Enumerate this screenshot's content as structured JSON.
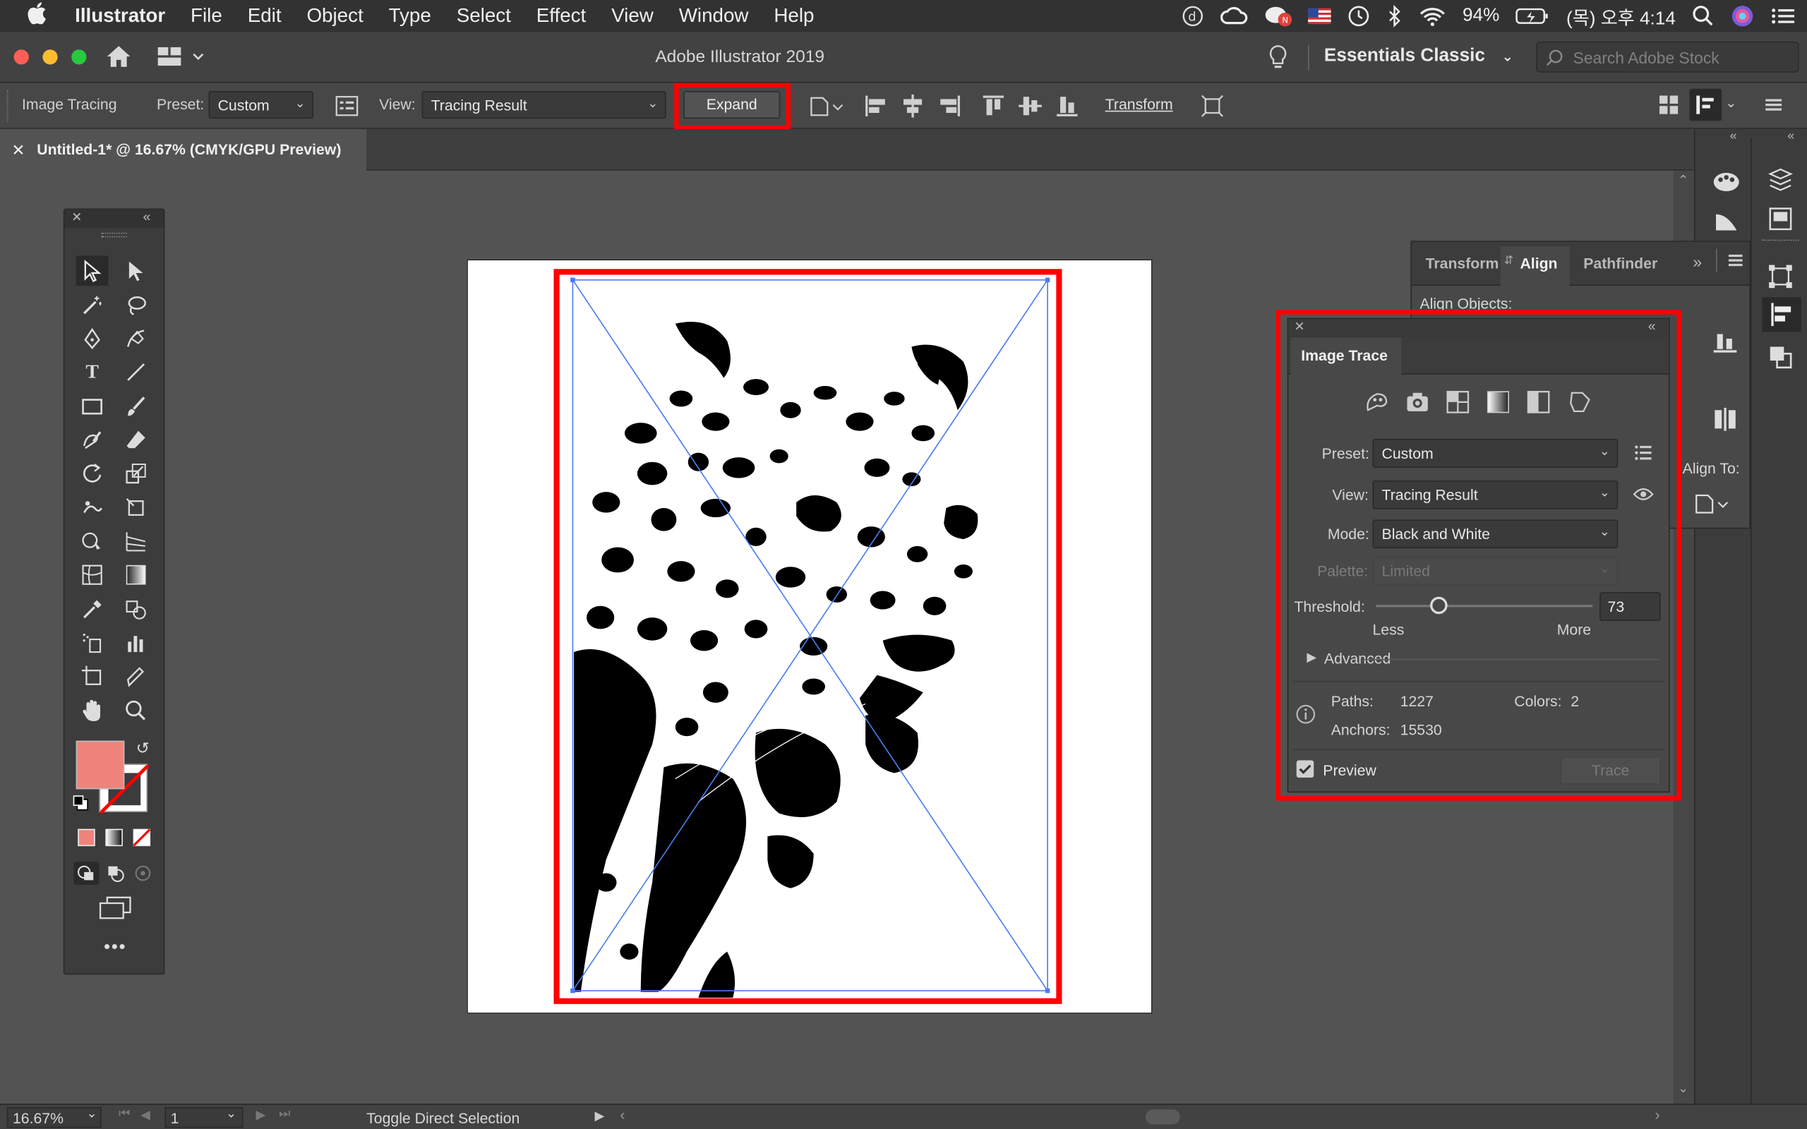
{
  "menubar": {
    "apple_icon": "apple-icon",
    "items": [
      "Illustrator",
      "File",
      "Edit",
      "Object",
      "Type",
      "Select",
      "Effect",
      "View",
      "Window",
      "Help"
    ],
    "battery": "94%",
    "clock": "(목) 오후 4:14"
  },
  "titlebar": {
    "title": "Adobe Illustrator 2019",
    "workspace": "Essentials Classic",
    "search_placeholder": "Search Adobe Stock"
  },
  "controlbar": {
    "mode_label": "Image Tracing",
    "preset_label": "Preset:",
    "preset_value": "Custom",
    "view_label": "View:",
    "view_value": "Tracing Result",
    "expand_label": "Expand",
    "transform_label": "Transform"
  },
  "document": {
    "tab_title": "Untitled-1* @ 16.67% (CMYK/GPU Preview)"
  },
  "align_panel": {
    "tabs": [
      "Transform",
      "Align",
      "Pathfinder"
    ],
    "align_objects_label": "Align Objects:",
    "align_to_label": "Align To:"
  },
  "image_trace": {
    "title": "Image Trace",
    "preset_label": "Preset:",
    "preset_value": "Custom",
    "view_label": "View:",
    "view_value": "Tracing Result",
    "mode_label": "Mode:",
    "mode_value": "Black and White",
    "palette_label": "Palette:",
    "palette_value": "Limited",
    "threshold_label": "Threshold:",
    "threshold_value": "73",
    "threshold_level": 0.29,
    "less_label": "Less",
    "more_label": "More",
    "advanced_label": "Advanced",
    "paths_label": "Paths:",
    "paths_value": "1227",
    "colors_label": "Colors:",
    "colors_value": "2",
    "anchors_label": "Anchors:",
    "anchors_value": "15530",
    "preview_label": "Preview",
    "trace_label": "Trace"
  },
  "statusbar": {
    "zoom": "16.67%",
    "page": "1",
    "status_text": "Toggle Direct Selection"
  },
  "colors": {
    "fill": "#f0837b",
    "highlight": "#ff0000",
    "selection": "#4a7bf0"
  }
}
